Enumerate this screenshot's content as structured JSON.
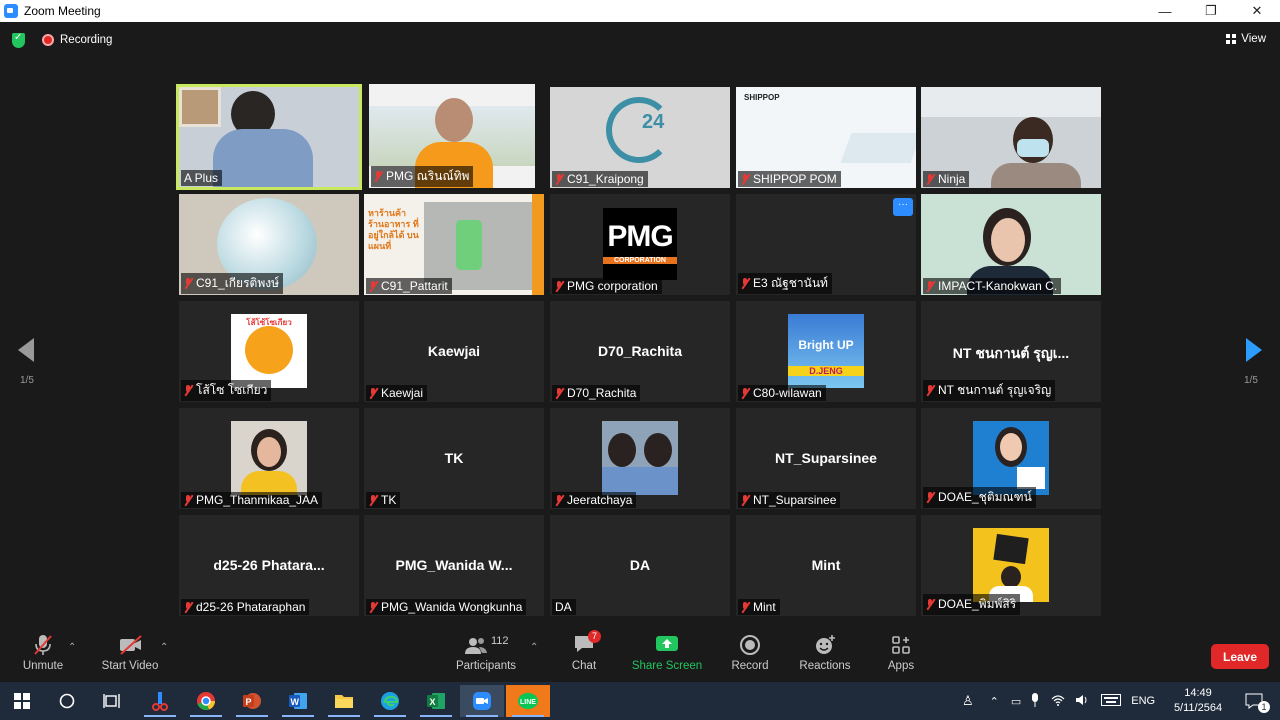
{
  "window": {
    "title": "Zoom Meeting"
  },
  "topbar": {
    "recording_label": "Recording",
    "view_label": "View"
  },
  "pager": {
    "left": "1/5",
    "right": "1/5"
  },
  "participants": [
    {
      "name": "A Plus",
      "center_name": "",
      "muted": false,
      "active": true
    },
    {
      "name": "PMG ณรินณ์ทิพ",
      "center_name": "",
      "muted": true
    },
    {
      "name": "C91_Kraipong",
      "center_name": "",
      "muted": true
    },
    {
      "name": "SHIPPOP POM",
      "center_name": "",
      "muted": true,
      "logo_text": "SHIPPOP"
    },
    {
      "name": "Ninja",
      "center_name": "",
      "muted": true
    },
    {
      "name": "C91_เกียรติพงษ์",
      "center_name": "",
      "muted": true
    },
    {
      "name": "C91_Pattarit",
      "center_name": "",
      "muted": true,
      "ad_text": "หาร้านค้า ร้านอาหาร ที่อยู่ใกล้ได้ บนแผนที่"
    },
    {
      "name": "PMG corporation",
      "center_name": "",
      "muted": true,
      "logo_text": "PMG",
      "logo_sub": "CORPORATION"
    },
    {
      "name": "E3 ณัฐชานันท์",
      "center_name": "",
      "muted": true,
      "more_icon": "···"
    },
    {
      "name": "IMPACT-Kanokwan C.",
      "center_name": "",
      "muted": true
    },
    {
      "name": "โส้โซ โซเกียว",
      "center_name": "",
      "muted": true,
      "logo_text": "โส้โซ้โซเกียว"
    },
    {
      "name": "Kaewjai",
      "center_name": "Kaewjai",
      "muted": true
    },
    {
      "name": "D70_Rachita",
      "center_name": "D70_Rachita",
      "muted": true
    },
    {
      "name": "C80-wilawan",
      "center_name": "",
      "muted": true,
      "logo_text": "Bright UP",
      "logo_sub": "D.JENG"
    },
    {
      "name": "NT ชนกานต์ รุญเจริญ",
      "center_name": "NT ชนกานต์ รุญเ...",
      "muted": true
    },
    {
      "name": "PMG_Thanmikaa_JAA",
      "center_name": "",
      "muted": true
    },
    {
      "name": "TK",
      "center_name": "TK",
      "muted": true
    },
    {
      "name": "Jeeratchaya",
      "center_name": "",
      "muted": true
    },
    {
      "name": "NT_Suparsinee",
      "center_name": "NT_Suparsinee",
      "muted": true
    },
    {
      "name": "DOAE_ชุติมณฑน์",
      "center_name": "",
      "muted": true
    },
    {
      "name": "d25-26 Phataraphan",
      "center_name": "d25-26 Phatara...",
      "muted": true
    },
    {
      "name": "PMG_Wanida Wongkunha",
      "center_name": "PMG_Wanida W...",
      "muted": true
    },
    {
      "name": "DA",
      "center_name": "DA",
      "muted": false
    },
    {
      "name": "Mint",
      "center_name": "Mint",
      "muted": true
    },
    {
      "name": "DOAE_พิมพ์สิริ",
      "center_name": "",
      "muted": true
    }
  ],
  "toolbar": {
    "unmute": "Unmute",
    "start_video": "Start Video",
    "participants": "Participants",
    "participants_count": "112",
    "chat": "Chat",
    "chat_badge": "7",
    "share_screen": "Share Screen",
    "record": "Record",
    "reactions": "Reactions",
    "apps": "Apps",
    "leave": "Leave"
  },
  "taskbar": {
    "lang": "ENG",
    "time": "14:49",
    "date": "5/11/2564",
    "notification_count": "1"
  },
  "colors": {
    "accent": "#2d8cff",
    "leave": "#e02828",
    "share": "#22c55e",
    "active_border": "#c8e860"
  }
}
